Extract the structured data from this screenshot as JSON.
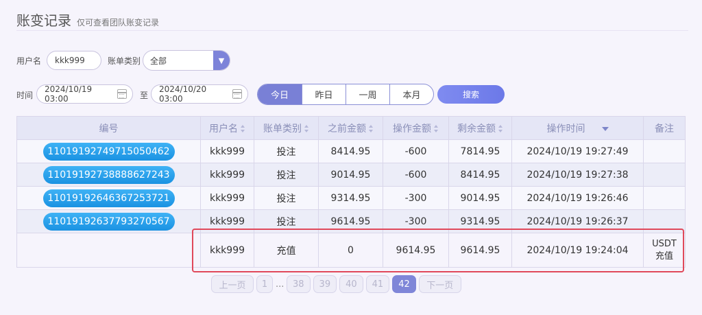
{
  "header": {
    "title": "账变记录",
    "subtitle": "仅可查看团队账变记录"
  },
  "filters": {
    "username_label": "用户名",
    "username_value": "kkk999",
    "type_label": "账单类别",
    "type_value": "全部",
    "time_label": "时间",
    "time_start": "2024/10/19 03:00",
    "to_label": "至",
    "time_end": "2024/10/20 03:00",
    "range_buttons": [
      "今日",
      "昨日",
      "一周",
      "本月"
    ],
    "selected_range": "今日",
    "search_label": "搜索"
  },
  "table": {
    "headers": [
      "编号",
      "用户名",
      "账单类别",
      "之前金额",
      "操作金额",
      "剩余金额",
      "操作时间",
      "备注"
    ],
    "rows": [
      {
        "id": "11019192749715050462",
        "user": "kkk999",
        "type": "投注",
        "before": "8414.95",
        "amount": "-600",
        "after": "7814.95",
        "time": "2024/10/19 19:27:49",
        "note": ""
      },
      {
        "id": "11019192738888627243",
        "user": "kkk999",
        "type": "投注",
        "before": "9014.95",
        "amount": "-600",
        "after": "8414.95",
        "time": "2024/10/19 19:27:38",
        "note": ""
      },
      {
        "id": "11019192646367253721",
        "user": "kkk999",
        "type": "投注",
        "before": "9314.95",
        "amount": "-300",
        "after": "9014.95",
        "time": "2024/10/19 19:26:46",
        "note": ""
      },
      {
        "id": "11019192637793270567",
        "user": "kkk999",
        "type": "投注",
        "before": "9614.95",
        "amount": "-300",
        "after": "9314.95",
        "time": "2024/10/19 19:26:37",
        "note": ""
      },
      {
        "id": "",
        "user": "kkk999",
        "type": "充值",
        "before": "0",
        "amount": "9614.95",
        "after": "9614.95",
        "time": "2024/10/19 19:24:04",
        "note_line1": "USDT",
        "note_line2": "充值"
      }
    ]
  },
  "pagination": {
    "prev": "上一页",
    "first": "1",
    "ellipsis": "...",
    "pages": [
      "38",
      "39",
      "40",
      "41",
      "42"
    ],
    "current": "42",
    "next": "下一页"
  },
  "colors": {
    "accent": "#7980d6",
    "id_pill": "#1a92e2",
    "highlight": "#e0485a"
  }
}
